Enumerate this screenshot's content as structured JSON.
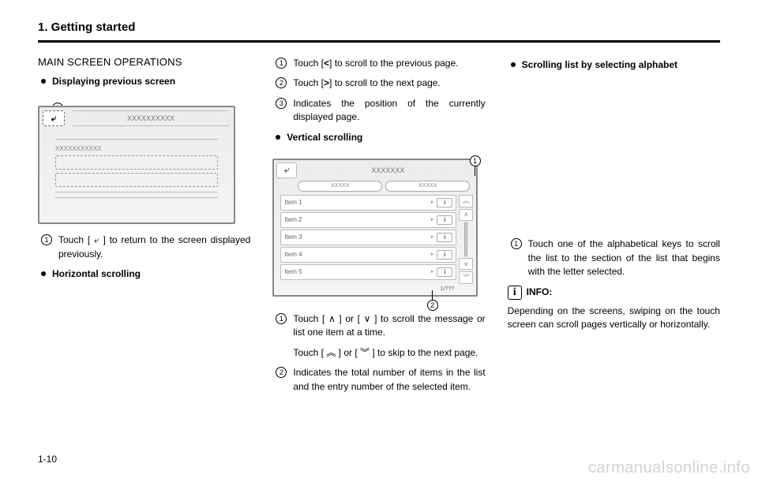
{
  "header": {
    "chapter": "1. Getting started"
  },
  "page_number": "1-10",
  "watermark": "carmanualsonline.info",
  "col1": {
    "section_title": "MAIN SCREEN OPERATIONS",
    "bullet_prev_screen": "Displaying previous screen",
    "fig1": {
      "callout1": "1",
      "back_symbol": "⤶",
      "title_placeholder": "XXXXXXXXXX",
      "row_placeholder": "XXXXXXXXXXX"
    },
    "step1": {
      "num": "1",
      "text": "Touch [ ⤶ ] to return to the screen displayed previously."
    },
    "bullet_horiz": "Horizontal scrolling"
  },
  "col2": {
    "step1": {
      "num": "1",
      "text_a": "Touch [",
      "bold": "<",
      "text_b": "] to scroll to the previous page."
    },
    "step2": {
      "num": "2",
      "text_a": "Touch [",
      "bold": ">",
      "text_b": "] to scroll to the next page."
    },
    "step3": {
      "num": "3",
      "text": "Indicates the position of the currently displayed page."
    },
    "bullet_vert": "Vertical scrolling",
    "fig2": {
      "callout1": "1",
      "callout2": "2",
      "title": "XXXXXXX",
      "tab1": "XXXXX",
      "tab2": "XXXXX",
      "items": [
        "Item 1",
        "Item 2",
        "Item 3",
        "Item 4",
        "Item 5"
      ],
      "footer": "1/???"
    },
    "step4": {
      "num": "1",
      "text": "Touch [ ∧ ] or [ ∨ ] to scroll the message or list one item at a time."
    },
    "step4b": "Touch [ ︽ ] or [ ︾ ] to skip to the next page.",
    "step5": {
      "num": "2",
      "text": "Indicates the total number of items in the list and the entry number of the selected item."
    }
  },
  "col3": {
    "bullet_alpha": "Scrolling list by selecting alphabet",
    "step1": {
      "num": "1",
      "text": "Touch one of the alphabetical keys to scroll the list to the section of the list that begins with the letter selected."
    },
    "info_icon": "i",
    "info_label": "INFO:",
    "info_body": "Depending on the screens, swiping on the touch screen can scroll pages vertically or horizontally."
  }
}
